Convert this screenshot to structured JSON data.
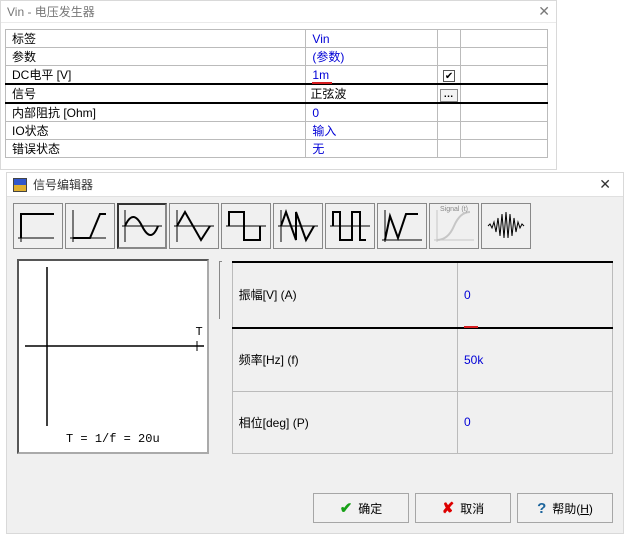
{
  "back_window": {
    "title": "Vin - 电压发生器",
    "rows": {
      "label": {
        "name": "标签",
        "value": "Vin"
      },
      "params": {
        "name": "参数",
        "value": "(参数)"
      },
      "dc_level": {
        "name": "DC电平 [V]",
        "value": "1m",
        "checked": true
      },
      "signal": {
        "name": "信号",
        "value": "正弦波"
      },
      "impedance": {
        "name": "内部阻抗 [Ohm]",
        "value": "0"
      },
      "io_state": {
        "name": "IO状态",
        "value": "输入"
      },
      "err_state": {
        "name": "错误状态",
        "value": "无"
      }
    }
  },
  "front_dialog": {
    "title": "信号编辑器",
    "waveform_names": [
      "dc-step",
      "ramp",
      "sine",
      "triangle",
      "square",
      "saw-up",
      "pulse",
      "noise-line",
      "signal-t",
      "noise-burst"
    ],
    "selected_waveform_index": 2,
    "preview": {
      "period_label": "T = 1/f = 20u",
      "T_marker": "T"
    },
    "params": {
      "amplitude": {
        "label": "振幅[V] (A)",
        "value": "0"
      },
      "frequency": {
        "label": "频率[Hz] (f)",
        "value": "50k"
      },
      "phase": {
        "label": "相位[deg] (P)",
        "value": "0"
      }
    },
    "buttons": {
      "ok": "确定",
      "cancel": "取消",
      "help": "帮助",
      "help_key": "H"
    }
  }
}
